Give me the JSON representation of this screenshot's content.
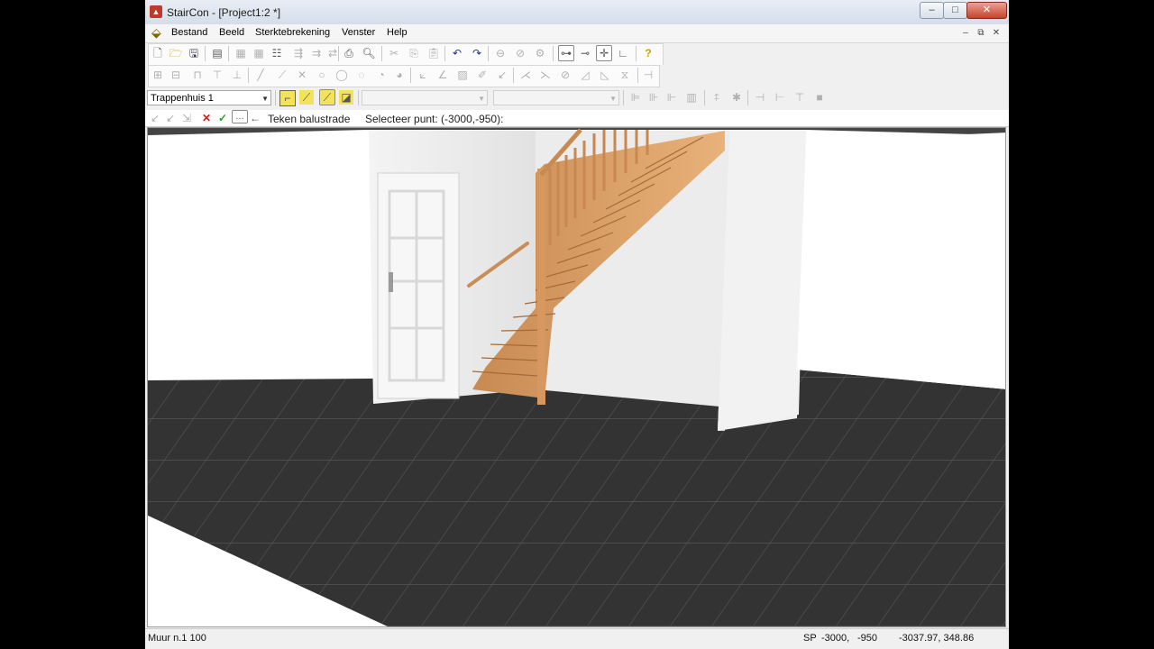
{
  "window": {
    "title": "StairCon - [Project1:2 *]"
  },
  "menu": [
    "Bestand",
    "Beeld",
    "Sterktebrekening",
    "Venster",
    "Help"
  ],
  "layer_combo": {
    "value": "Trappenhuis 1"
  },
  "command": {
    "name": "Teken balustrade",
    "prompt": "Selecteer punt: (-3000,-950):"
  },
  "status": {
    "object": "Muur n.1 100",
    "sp_label": "SP",
    "sp_x": "-3000,",
    "sp_y": "-950",
    "coords": "-3037.97, 348.86"
  },
  "icons": {
    "title_controls": [
      "minimize-icon",
      "maximize-icon",
      "close-icon"
    ],
    "mdi_controls": [
      "mdi-minimize-icon",
      "mdi-restore-icon",
      "mdi-close-icon"
    ],
    "command_bar": [
      "cancel-icon",
      "confirm-icon",
      "more-icon",
      "back-icon"
    ]
  }
}
